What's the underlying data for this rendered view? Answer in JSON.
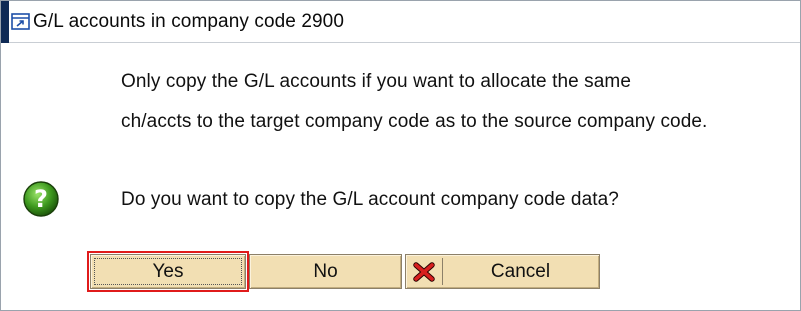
{
  "window": {
    "title": "G/L accounts in company code 2900"
  },
  "message": {
    "line1": "Only copy the G/L accounts if you want to allocate the same",
    "line2": "ch/accts to the target company code as to the source company code.",
    "question": "Do you want to copy the G/L account company code data?"
  },
  "icons": {
    "title": "popup-window-icon",
    "question": "question-mark-icon",
    "cancel": "red-x-icon"
  },
  "buttons": {
    "yes": "Yes",
    "no": "No",
    "cancel": "Cancel"
  },
  "colors": {
    "title_edge": "#0f2a55",
    "button_face": "#f2dfb3",
    "focus_highlight": "#e01b1b",
    "question_icon": "#3e9a1f"
  }
}
